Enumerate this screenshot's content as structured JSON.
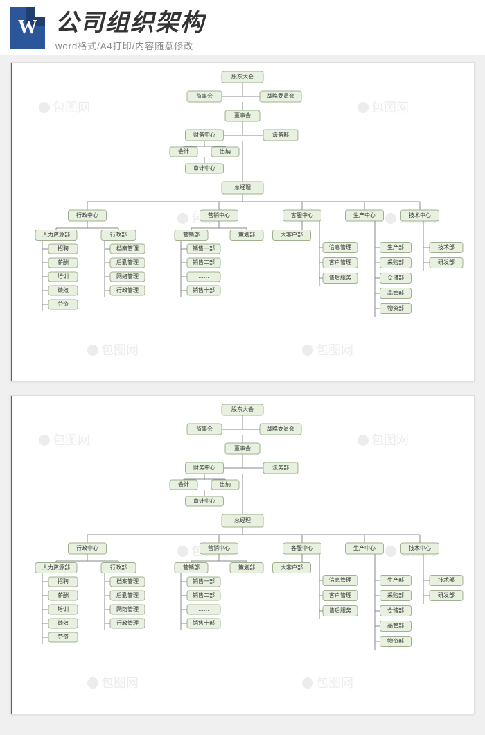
{
  "header": {
    "title": "公司组织架构",
    "subtitle": "word格式/A4打印/内容随意修改",
    "icon_name": "word-icon"
  },
  "watermark_text": "包图网",
  "org_chart": {
    "root": "股东大会",
    "level2": {
      "left": "监事会",
      "right": "战略委员会"
    },
    "level3": "董事会",
    "level4": {
      "left": "财务中心",
      "right": "法务部"
    },
    "level4_sub": {
      "left": "会计",
      "right": "出纳",
      "below": "审计中心"
    },
    "level5": "总经理",
    "centers": [
      {
        "name": "行政中心",
        "depts": [
          {
            "name": "人力资源部",
            "items": [
              "招聘",
              "薪酬",
              "培训",
              "绩效",
              "劳资"
            ]
          },
          {
            "name": "行政部",
            "items": [
              "档案管理",
              "后勤管理",
              "网络管理",
              "行政管理"
            ]
          }
        ]
      },
      {
        "name": "营销中心",
        "depts": [
          {
            "name": "营销部",
            "items": []
          },
          {
            "name": "策划部",
            "items": [
              "销售一部",
              "销售二部",
              "……",
              "销售十部"
            ]
          }
        ]
      },
      {
        "name": "客服中心",
        "depts": [
          {
            "name": "大客户部",
            "items": [
              "信息管理",
              "客户管理",
              "售后服务"
            ]
          }
        ]
      },
      {
        "name": "生产中心",
        "depts": [
          {
            "name": "",
            "items": [
              "生产部",
              "采购部",
              "仓储部",
              "品管部",
              "物资部"
            ]
          }
        ]
      },
      {
        "name": "技术中心",
        "depts": [
          {
            "name": "",
            "items": [
              "技术部",
              "研发部"
            ]
          }
        ]
      }
    ]
  }
}
